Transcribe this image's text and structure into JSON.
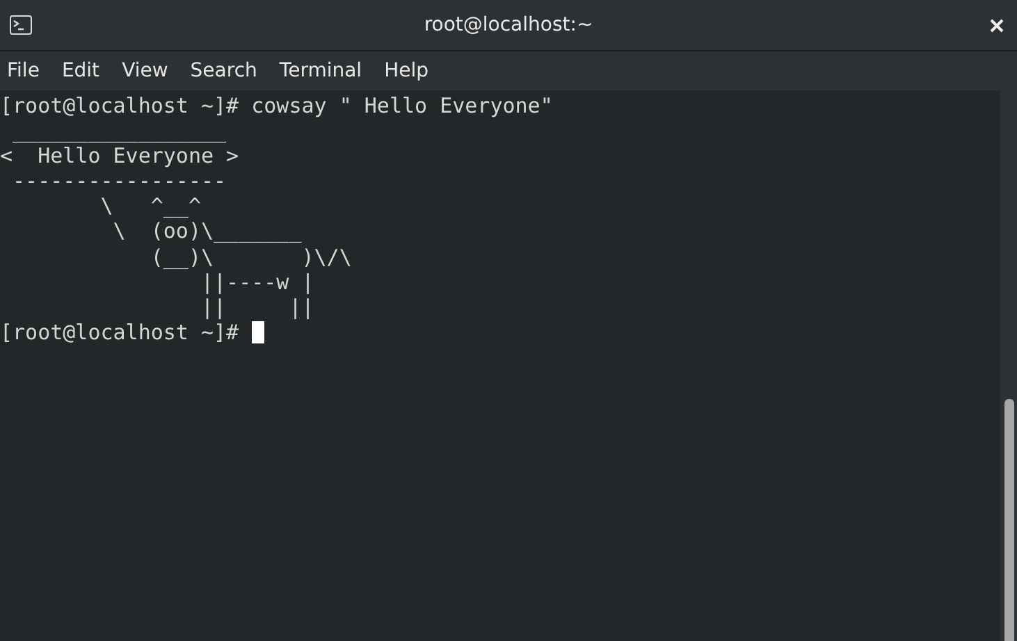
{
  "window": {
    "title": "root@localhost:~"
  },
  "menu": [
    "File",
    "Edit",
    "View",
    "Search",
    "Terminal",
    "Help"
  ],
  "terminal": {
    "lines": [
      "[root@localhost ~]# cowsay \" Hello Everyone\"",
      " _________________",
      "<  Hello Everyone >",
      " -----------------",
      "        \\   ^__^",
      "         \\  (oo)\\_______",
      "            (__)\\       )\\/\\",
      "                ||----w |",
      "                ||     ||"
    ],
    "prompt": "[root@localhost ~]# "
  }
}
